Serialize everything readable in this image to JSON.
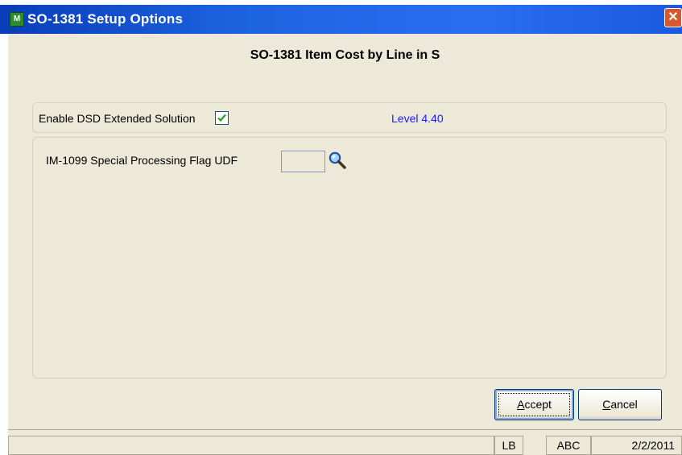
{
  "window": {
    "title": "SO-1381 Setup Options",
    "app_icon_text": "M",
    "close_glyph": "✕"
  },
  "main": {
    "heading": "SO-1381 Item Cost by Line in S",
    "enable_dsd": {
      "label": "Enable DSD Extended Solution",
      "checked": true
    },
    "level_text": "Level  4.40",
    "udf": {
      "label": "IM-1099 Special Processing Flag UDF",
      "value": "",
      "lookup_icon": "magnifier-icon"
    }
  },
  "buttons": {
    "accept_first": "A",
    "accept_rest": "ccept",
    "cancel_first": "C",
    "cancel_rest": "ancel"
  },
  "statusbar": {
    "main": "",
    "user": "LB",
    "company": "ABC",
    "date": "2/2/2011"
  },
  "colors": {
    "title_bar": "#1c63e0",
    "dialog_bg": "#ece9d8",
    "level_text": "#1a1aff",
    "close_button": "#d9572c",
    "checkmark": "#21a121"
  }
}
